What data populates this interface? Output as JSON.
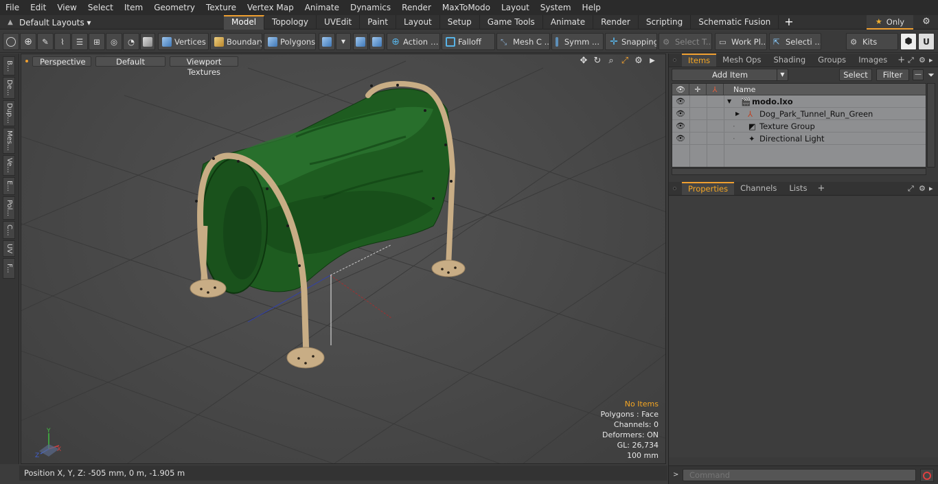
{
  "menu": [
    "File",
    "Edit",
    "View",
    "Select",
    "Item",
    "Geometry",
    "Texture",
    "Vertex Map",
    "Animate",
    "Dynamics",
    "Render",
    "MaxToModo",
    "Layout",
    "System",
    "Help"
  ],
  "layouts": {
    "label": "Default Layouts ▾"
  },
  "tabs": [
    {
      "label": "Model"
    },
    {
      "label": "Topology"
    },
    {
      "label": "UVEdit"
    },
    {
      "label": "Paint"
    },
    {
      "label": "Layout"
    },
    {
      "label": "Setup"
    },
    {
      "label": "Game Tools"
    },
    {
      "label": "Animate"
    },
    {
      "label": "Render"
    },
    {
      "label": "Scripting"
    },
    {
      "label": "Schematic Fusion"
    }
  ],
  "tab_plus": "+",
  "only": {
    "label": "Only"
  },
  "toolbar": {
    "vertices": "Vertices",
    "boundary": "Boundary",
    "polygons": "Polygons",
    "action": "Action",
    "falloff": "Falloff",
    "mesh": "Mesh C ...",
    "symm": "Symm ...",
    "snapping": "Snapping",
    "select_t": "Select T...",
    "work_pl": "Work Pl...",
    "selecti": "Selecti ...",
    "kits": "Kits"
  },
  "left_tabs": [
    "B...",
    "De...",
    "Dup...",
    "Mes...",
    "Ve...",
    "E...",
    "Pol...",
    "C...",
    "UV",
    "F..."
  ],
  "viewport": {
    "view": "Perspective",
    "shading": "Default",
    "textures": "Viewport Textures",
    "info": {
      "selection": "No Items",
      "polygons": "Polygons : Face",
      "channels": "Channels: 0",
      "deformers": "Deformers: ON",
      "gl": "GL: 26,734",
      "grid": "100 mm"
    },
    "axes": {
      "x": "X",
      "y": "Y",
      "z": "Z"
    }
  },
  "status": {
    "position": "Position X, Y, Z:   -505 mm, 0 m, -1.905 m"
  },
  "items_panel": {
    "tabs": [
      "Items",
      "Mesh Ops",
      "Shading",
      "Groups",
      "Images"
    ],
    "add_item": "Add Item",
    "select": "Select",
    "filter": "Filter",
    "name_header": "Name",
    "rows": [
      {
        "name": "modo.lxo"
      },
      {
        "name": "Dog_Park_Tunnel_Run_Green"
      },
      {
        "name": "Texture Group"
      },
      {
        "name": "Directional Light"
      }
    ]
  },
  "properties_panel": {
    "tabs": [
      "Properties",
      "Channels",
      "Lists"
    ]
  },
  "command": {
    "placeholder": "Command"
  },
  "colors": {
    "accent": "#f0a030",
    "tunnel": "#1d5a1e",
    "frame": "#c8ad85",
    "list_bg": "#8e8f91"
  },
  "icons": [
    "upload-icon",
    "star-icon",
    "gear-icon",
    "eye-icon",
    "move-icon",
    "rotate-icon",
    "zoom-icon",
    "expand-icon",
    "funnel-icon",
    "record-icon"
  ]
}
